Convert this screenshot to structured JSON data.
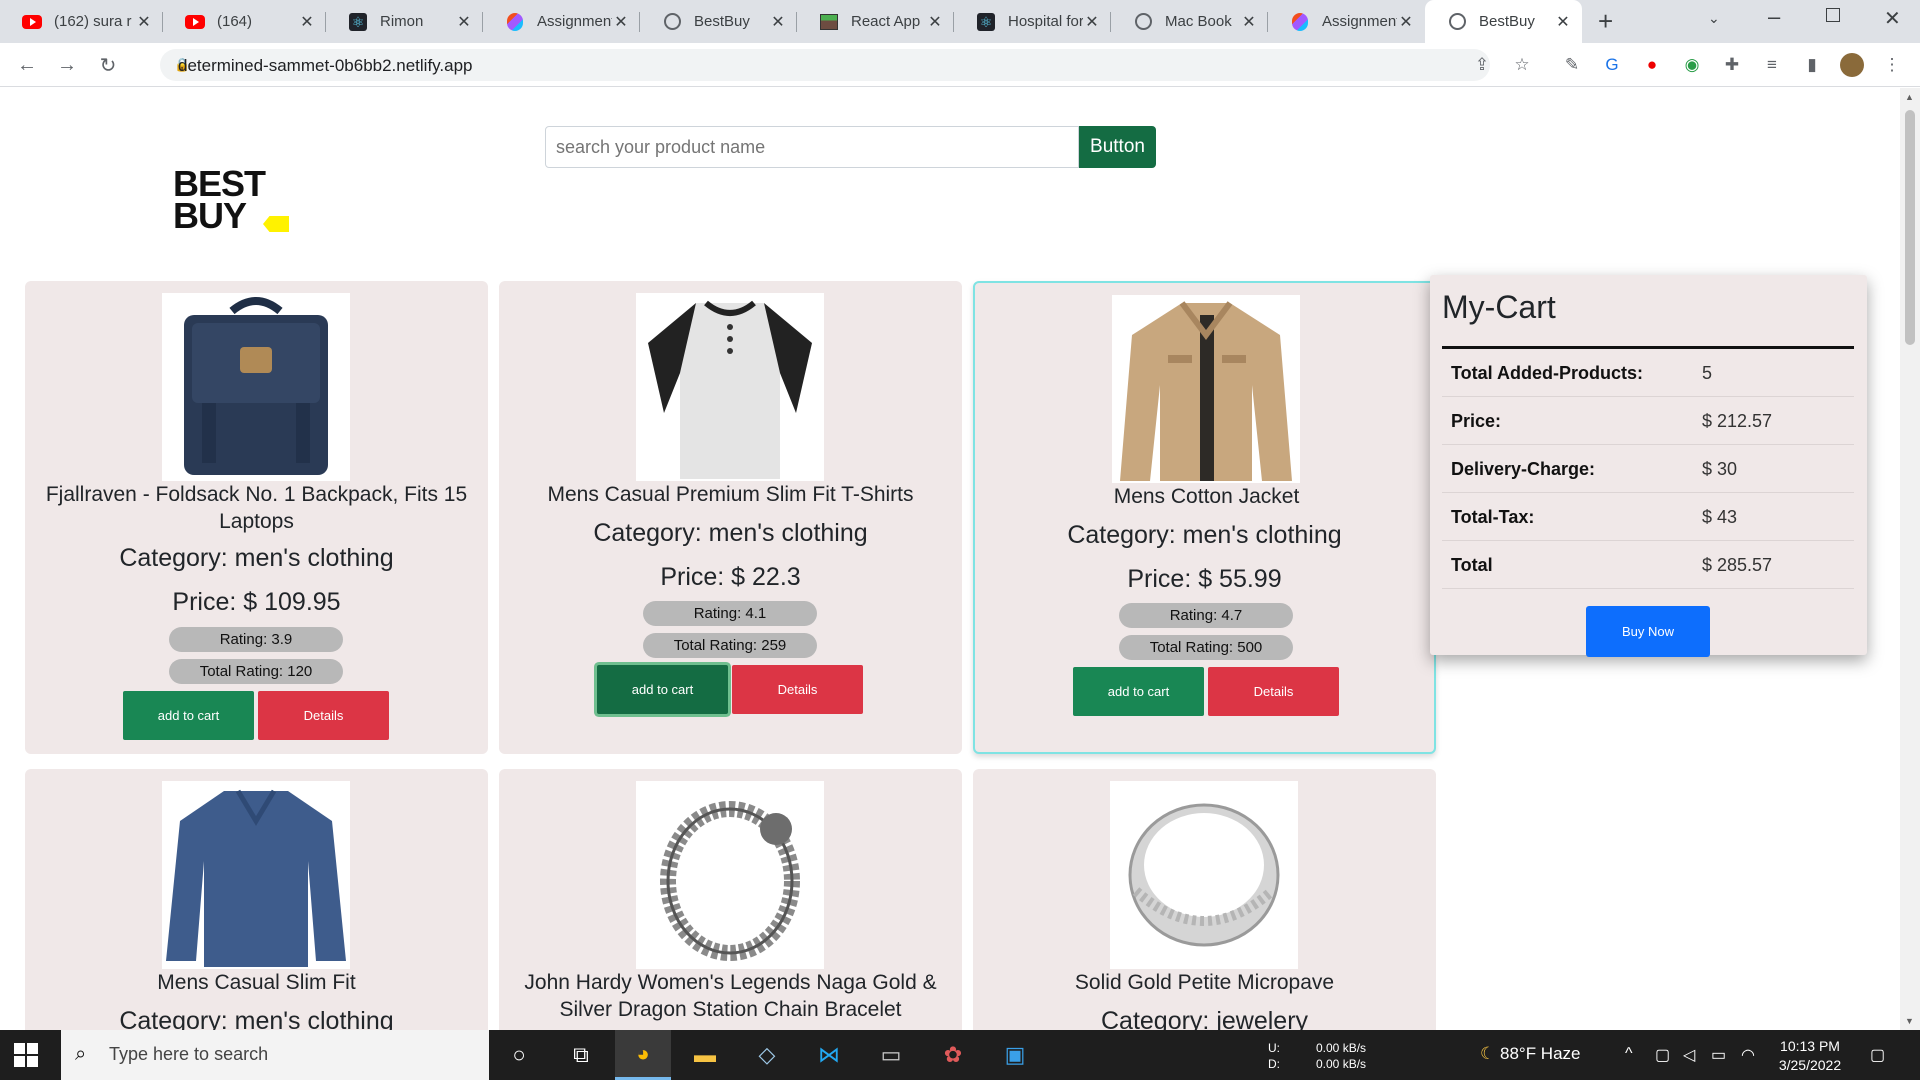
{
  "browser": {
    "tabs": [
      {
        "title": "(162) sura r",
        "icon": "youtube-icon"
      },
      {
        "title": "(164)",
        "icon": "youtube-icon"
      },
      {
        "title": "Rimon",
        "icon": "react-icon"
      },
      {
        "title": "Assignment",
        "icon": "figma-icon"
      },
      {
        "title": "BestBuy",
        "icon": "globe-icon"
      },
      {
        "title": "React App",
        "icon": "image-icon"
      },
      {
        "title": "Hospital for",
        "icon": "react-icon"
      },
      {
        "title": "Mac Book",
        "icon": "globe-icon"
      },
      {
        "title": "Assignment",
        "icon": "figma-icon"
      },
      {
        "title": "BestBuy",
        "icon": "globe-icon"
      }
    ],
    "active_tab": 9,
    "url": "determined-sammet-0b6bb2.netlify.app"
  },
  "header": {
    "logo_line1": "BEST",
    "logo_line2": "BUY",
    "search_placeholder": "search your product name",
    "search_button": "Button"
  },
  "products": [
    {
      "name": "Fjallraven - Foldsack No. 1 Backpack, Fits 15 Laptops",
      "category": "Category: men's clothing",
      "price": "Price: $ 109.95",
      "rating": "Rating: 3.9",
      "total_rating": "Total Rating: 120",
      "add_label": "add to cart",
      "details_label": "Details"
    },
    {
      "name": "Mens Casual Premium Slim Fit T-Shirts",
      "category": "Category: men's clothing",
      "price": "Price: $ 22.3",
      "rating": "Rating: 4.1",
      "total_rating": "Total Rating: 259",
      "add_label": "add to cart",
      "details_label": "Details"
    },
    {
      "name": "Mens Cotton Jacket",
      "category": "Category: men's clothing",
      "price": "Price: $ 55.99",
      "rating": "Rating: 4.7",
      "total_rating": "Total Rating: 500",
      "add_label": "add to cart",
      "details_label": "Details"
    },
    {
      "name": "Mens Casual Slim Fit",
      "category": "Category: men's clothing"
    },
    {
      "name": "John Hardy Women's Legends Naga Gold & Silver Dragon Station Chain Bracelet",
      "category": ""
    },
    {
      "name": "Solid Gold Petite Micropave",
      "category": "Category: jewelery"
    }
  ],
  "cart": {
    "title": "My-Cart",
    "rows": [
      {
        "label": "Total Added-Products:",
        "value": "5"
      },
      {
        "label": "Price:",
        "value": "$ 212.57"
      },
      {
        "label": "Delivery-Charge:",
        "value": "$ 30"
      },
      {
        "label": "Total-Tax:",
        "value": "$ 43"
      },
      {
        "label": "Total",
        "value": "$ 285.57"
      }
    ],
    "buy_label": "Buy Now"
  },
  "taskbar": {
    "search_text": "Type here to search",
    "net_up_label": "U:",
    "net_up": "0.00 kB/s",
    "net_down_label": "D:",
    "net_down": "0.00 kB/s",
    "weather": "88°F Haze",
    "time": "10:13 PM",
    "date": "3/25/2022"
  },
  "colors": {
    "card_bg": "#f0e8e8",
    "add_green": "#198754",
    "details_red": "#dc3545",
    "buy_blue": "#0d6efd",
    "search_button": "#146c43"
  }
}
